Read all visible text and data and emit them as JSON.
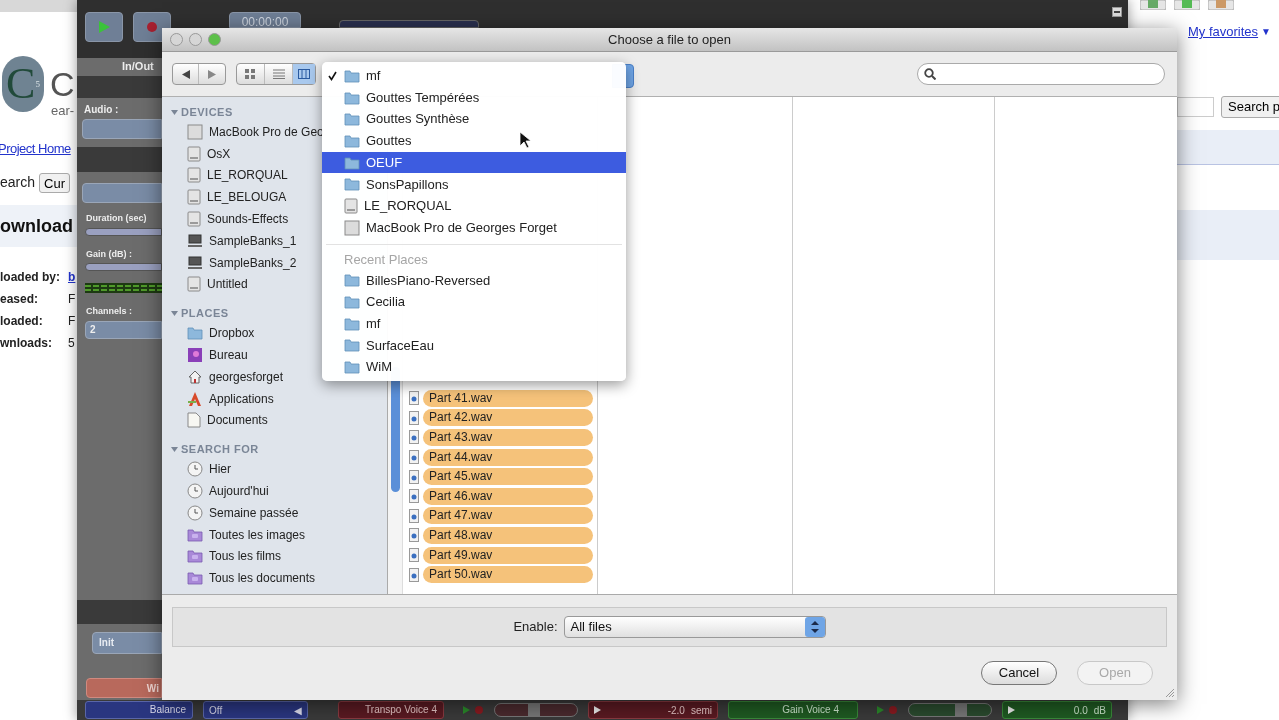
{
  "browser": {
    "logo_text": "C",
    "logo_sub": "5",
    "title_part": "C",
    "subtitle": "ear-",
    "project_link": "Project Home",
    "search_label": "earch",
    "search_button": "Cur",
    "heading": "ownload",
    "details": [
      {
        "label": "loaded by:",
        "value": "b",
        "kind": "link"
      },
      {
        "label": "eased:",
        "value": "F",
        "kind": "text"
      },
      {
        "label": "loaded:",
        "value": "F",
        "kind": "text"
      },
      {
        "label": "wnloads:",
        "value": "5",
        "kind": "text"
      }
    ],
    "favorites": "My favorites",
    "favorites_arrow": "▼",
    "search_right": "Search p"
  },
  "audio_app": {
    "time": "00:00:00",
    "tab": "In/Out",
    "audio_label": "Audio :",
    "duration_label": "Duration (sec)",
    "gain_label": "Gain (dB) :",
    "channels_label": "Channels :",
    "channels_value": "2",
    "init_field": "Init",
    "red_button": "Wi",
    "bottom": {
      "balance": "Balance",
      "balance_value": "Off",
      "balance_arrow": "◀",
      "transpo": "Transpo Voice 4",
      "transpo_slider": {
        "level": 0.47
      },
      "transpo_value": "-2.0",
      "transpo_unit": "semi",
      "gain": "Gain Voice 4",
      "gain_slider": {
        "level": 0.66
      },
      "gain_value": "0.0",
      "gain_unit": "dB"
    }
  },
  "dialog": {
    "title": "Choose a file to open",
    "sidebar": [
      {
        "title": "DEVICES",
        "expanded": true,
        "items": [
          {
            "label": "MacBook Pro de Geo",
            "kind": "computer"
          },
          {
            "label": "OsX",
            "kind": "drive"
          },
          {
            "label": "LE_RORQUAL",
            "kind": "drive"
          },
          {
            "label": "LE_BELOUGA",
            "kind": "drive"
          },
          {
            "label": "Sounds-Effects",
            "kind": "drive"
          },
          {
            "label": "SampleBanks_1",
            "kind": "network"
          },
          {
            "label": "SampleBanks_2",
            "kind": "network"
          },
          {
            "label": "Untitled",
            "kind": "drive"
          }
        ]
      },
      {
        "title": "PLACES",
        "expanded": true,
        "items": [
          {
            "label": "Dropbox",
            "kind": "folder"
          },
          {
            "label": "Bureau",
            "kind": "desktop"
          },
          {
            "label": "georgesforget",
            "kind": "home"
          },
          {
            "label": "Applications",
            "kind": "applications"
          },
          {
            "label": "Documents",
            "kind": "documents"
          }
        ]
      },
      {
        "title": "SEARCH FOR",
        "expanded": true,
        "items": [
          {
            "label": "Hier",
            "kind": "clock"
          },
          {
            "label": "Aujourd'hui",
            "kind": "clock"
          },
          {
            "label": "Semaine passée",
            "kind": "clock"
          },
          {
            "label": "Toutes les images",
            "kind": "smart-folder"
          },
          {
            "label": "Tous les films",
            "kind": "smart-folder"
          },
          {
            "label": "Tous les documents",
            "kind": "smart-folder"
          }
        ]
      }
    ],
    "files": [
      {
        "name": "Part 41.wav",
        "selected": true
      },
      {
        "name": "Part 42.wav",
        "selected": true
      },
      {
        "name": "Part 43.wav",
        "selected": true
      },
      {
        "name": "Part 44.wav",
        "selected": true
      },
      {
        "name": "Part 45.wav",
        "selected": true
      },
      {
        "name": "Part 46.wav",
        "selected": true
      },
      {
        "name": "Part 47.wav",
        "selected": true
      },
      {
        "name": "Part 48.wav",
        "selected": true
      },
      {
        "name": "Part 49.wav",
        "selected": true
      },
      {
        "name": "Part 50.wav",
        "selected": true
      }
    ],
    "enable_label": "Enable:",
    "enable_value": "All files",
    "buttons": [
      {
        "label": "Cancel",
        "disabled": false
      },
      {
        "label": "Open",
        "disabled": true
      }
    ]
  },
  "path_menu": {
    "items": [
      {
        "label": "mf",
        "kind": "folder",
        "checked": true,
        "selected": false
      },
      {
        "label": "Gouttes Tempérées",
        "kind": "folder",
        "checked": false,
        "selected": false
      },
      {
        "label": "Gouttes Synthèse",
        "kind": "folder",
        "checked": false,
        "selected": false
      },
      {
        "label": "Gouttes",
        "kind": "folder",
        "checked": false,
        "selected": false
      },
      {
        "label": "OEUF",
        "kind": "folder",
        "checked": false,
        "selected": true
      },
      {
        "label": "SonsPapillons",
        "kind": "folder",
        "checked": false,
        "selected": false
      },
      {
        "label": "LE_RORQUAL",
        "kind": "drive",
        "checked": false,
        "selected": false
      },
      {
        "label": "MacBook Pro de Georges Forget",
        "kind": "computer",
        "checked": false,
        "selected": false
      }
    ],
    "recent_heading": "Recent Places",
    "recent": [
      {
        "label": "BillesPiano-Reversed",
        "kind": "folder"
      },
      {
        "label": "Cecilia",
        "kind": "folder"
      },
      {
        "label": "mf",
        "kind": "folder"
      },
      {
        "label": "SurfaceEau",
        "kind": "folder"
      },
      {
        "label": "WiM",
        "kind": "folder"
      }
    ]
  }
}
